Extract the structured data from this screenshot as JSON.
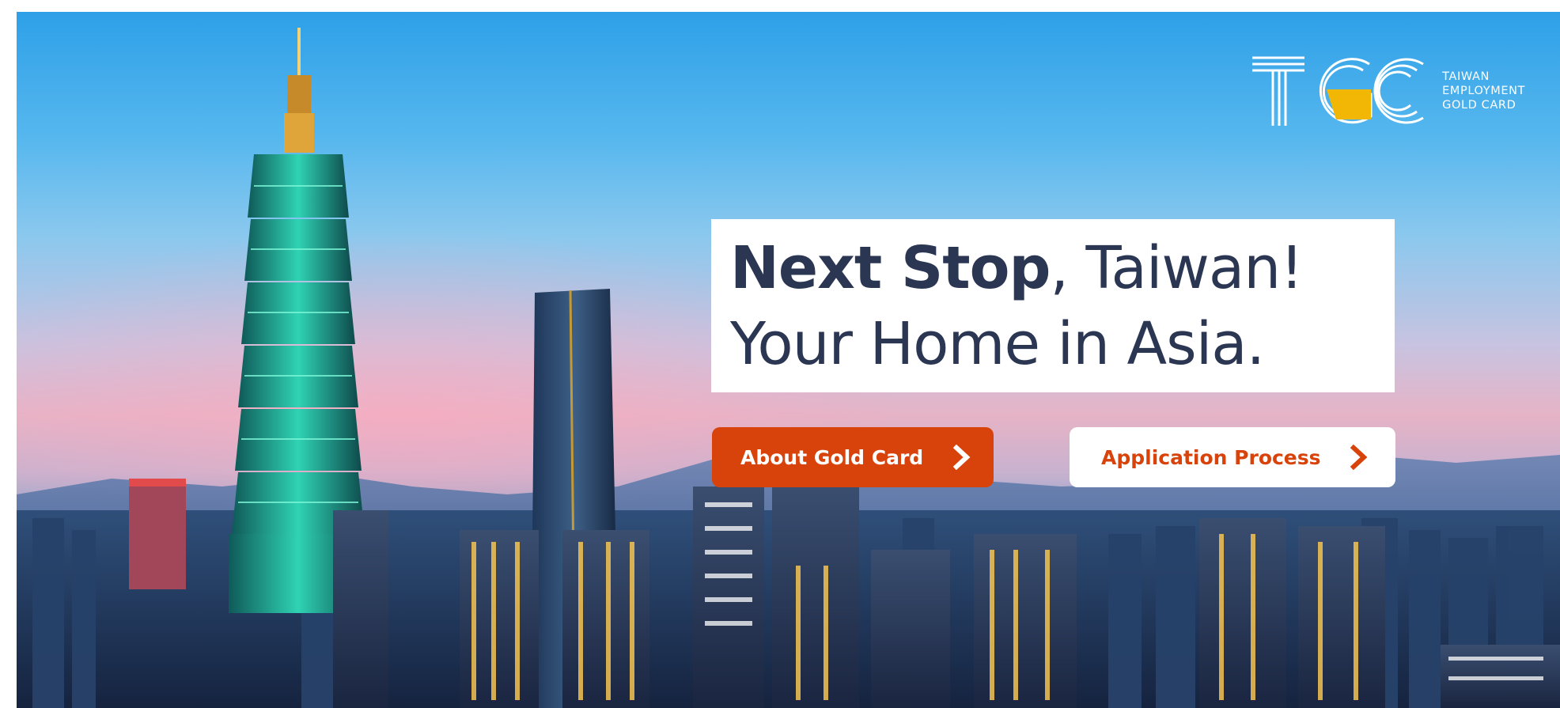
{
  "logo": {
    "mark_text": "TGC",
    "line1": "TAIWAN",
    "line2": "EMPLOYMENT",
    "line3": "GOLD CARD",
    "accent_color": "#f2b705"
  },
  "hero": {
    "headline_line1_bold": "Next Stop",
    "headline_line1_rest": ", Taiwan!",
    "headline_line2": "Your Home in Asia."
  },
  "buttons": {
    "about_label": "About Gold Card",
    "application_label": "Application Process",
    "icon": "chevron-right-icon"
  },
  "colors": {
    "headline_text": "#2b3653",
    "brand_orange": "#d7430b"
  }
}
